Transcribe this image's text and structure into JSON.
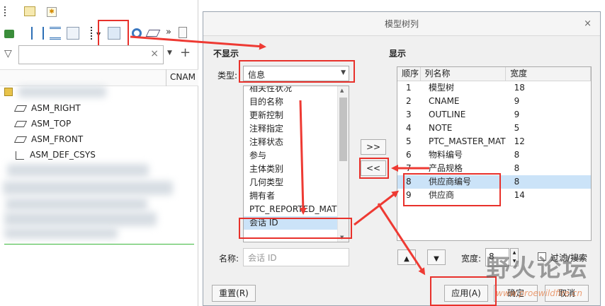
{
  "left_panel": {
    "column_header": "CNAM",
    "search": {
      "value": "",
      "clear_label": "×"
    },
    "tree_items": [
      "ASM_RIGHT",
      "ASM_TOP",
      "ASM_FRONT",
      "ASM_DEF_CSYS"
    ]
  },
  "dialog": {
    "title": "模型树列",
    "close_label": "×",
    "not_shown_label": "不显示",
    "shown_label": "显示",
    "type_label": "类型:",
    "type_value": "信息",
    "available_items": [
      "相关性状况",
      "目的名称",
      "更新控制",
      "注释指定",
      "注释状态",
      "参与",
      "主体类别",
      "几何类型",
      "拥有者",
      "PTC_REPORTED_MAT",
      "会话 ID"
    ],
    "selected_available_index": 10,
    "add_button": ">>",
    "remove_button": "<<",
    "columns_headers": [
      "顺序",
      "列名称",
      "宽度"
    ],
    "columns": [
      {
        "order": "1",
        "name": "模型树",
        "width": "18"
      },
      {
        "order": "2",
        "name": "CNAME",
        "width": "9"
      },
      {
        "order": "3",
        "name": "OUTLINE",
        "width": "9"
      },
      {
        "order": "4",
        "name": "NOTE",
        "width": "5"
      },
      {
        "order": "5",
        "name": "PTC_MASTER_MAT",
        "width": "12"
      },
      {
        "order": "6",
        "name": "物料编号",
        "width": "8"
      },
      {
        "order": "7",
        "name": "产品规格",
        "width": "8"
      },
      {
        "order": "8",
        "name": "供应商编号",
        "width": "8"
      },
      {
        "order": "9",
        "name": "供应商",
        "width": "14"
      }
    ],
    "selected_column_index": 7,
    "name_label": "名称:",
    "name_value": "会话 ID",
    "width_label": "宽度:",
    "width_value": "8",
    "filter_label": "过滤/搜索",
    "reset_button": "重置(R)",
    "apply_button": "应用(A)",
    "ok_button": "确定",
    "cancel_button": "取消"
  },
  "watermark": {
    "brand": "野火论坛",
    "url": "www.proewildfire.cn"
  },
  "colors": {
    "annotation_red": "#e8312b",
    "selection_blue": "#cbe3f8"
  }
}
